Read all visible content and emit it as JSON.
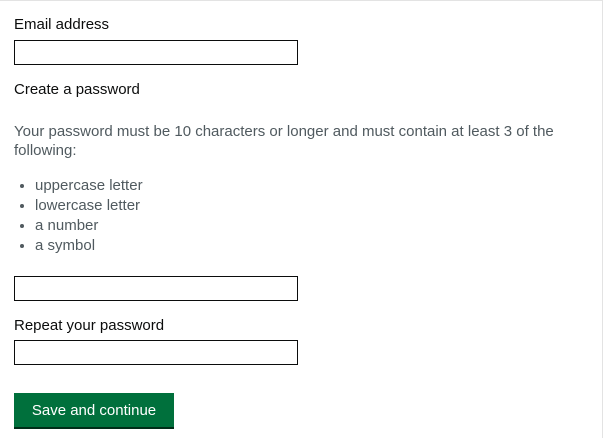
{
  "email": {
    "label": "Email address",
    "value": ""
  },
  "password": {
    "heading": "Create a password",
    "hint": "Your password must be 10 characters or longer and must contain at least 3 of the following:",
    "rules": [
      "uppercase letter",
      "lowercase letter",
      "a number",
      "a symbol"
    ],
    "value": ""
  },
  "repeat_password": {
    "label": "Repeat your password",
    "value": ""
  },
  "actions": {
    "submit_label": "Save and continue",
    "submit_color": "#00703c"
  }
}
